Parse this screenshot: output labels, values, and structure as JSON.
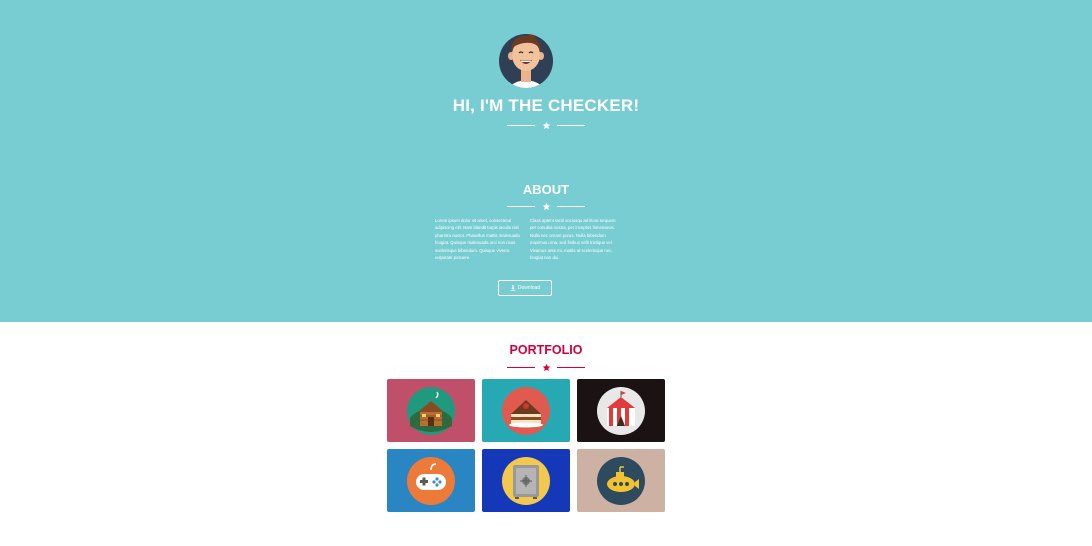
{
  "colors": {
    "hero_bg": "#78cdd2",
    "accent": "#d4003c",
    "text_on_hero": "#ffffff"
  },
  "hero": {
    "title": "HI, I'M THE CHECKER!",
    "avatar_icon": "person-avatar-icon"
  },
  "about": {
    "title": "ABOUT",
    "col1": "Lorem ipsum dolor sit amet, consectetur adipiscing elit. Nam blandit turpis iaculis nisl pharetra auctor. Phasellus mattis malesuada feugiat. Quisque malesuada orci non risus scelerisque bibendum. Quisque viverra vulputate posuere.",
    "col2": "Class aptent taciti sociosqu ad litora torquent per conubia nostra, per inceptos himenaeos. Nulla nec ornare purus. Nulla bibendum maximus urna, sed finibus velit tristique vel. Vivamus ante mi, mattis at scelerisque nec, feugiat non dui.",
    "download_label": "Download",
    "download_icon": "download-icon"
  },
  "portfolio": {
    "title": "PORTFOLIO",
    "items": [
      {
        "name": "cabin",
        "icon": "cabin-icon",
        "bg": "#c0506a"
      },
      {
        "name": "cake",
        "icon": "cake-icon",
        "bg": "#27a9b4"
      },
      {
        "name": "circus",
        "icon": "circus-tent-icon",
        "bg": "#1b1313"
      },
      {
        "name": "game",
        "icon": "gamepad-icon",
        "bg": "#2a86c2"
      },
      {
        "name": "safe",
        "icon": "safe-icon",
        "bg": "#1538b8"
      },
      {
        "name": "submarine",
        "icon": "submarine-icon",
        "bg": "#cdb1a3"
      }
    ]
  }
}
